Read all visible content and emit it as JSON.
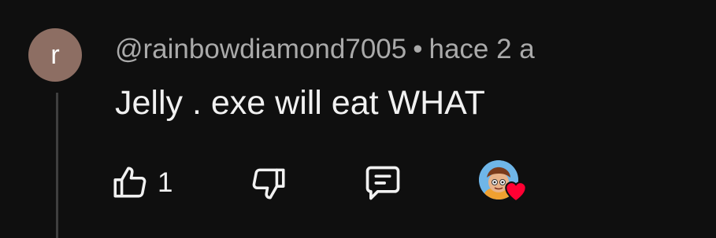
{
  "comment": {
    "avatar_letter": "r",
    "author": "@rainbowdiamond7005",
    "separator": "•",
    "timestamp": "hace 2 a",
    "text": "Jelly . exe will eat WHAT"
  },
  "actions": {
    "like_count": "1",
    "icons": [
      "thumbs-up-icon",
      "thumbs-down-icon",
      "reply-icon",
      "creator-heart-icon"
    ]
  },
  "colors": {
    "background": "#0f0f0f",
    "avatar": "#8d6e63",
    "text_primary": "#f1f1f1",
    "text_secondary": "#aaaaaa",
    "thread_line": "#3f3f3f",
    "heart": "#ff0033"
  }
}
